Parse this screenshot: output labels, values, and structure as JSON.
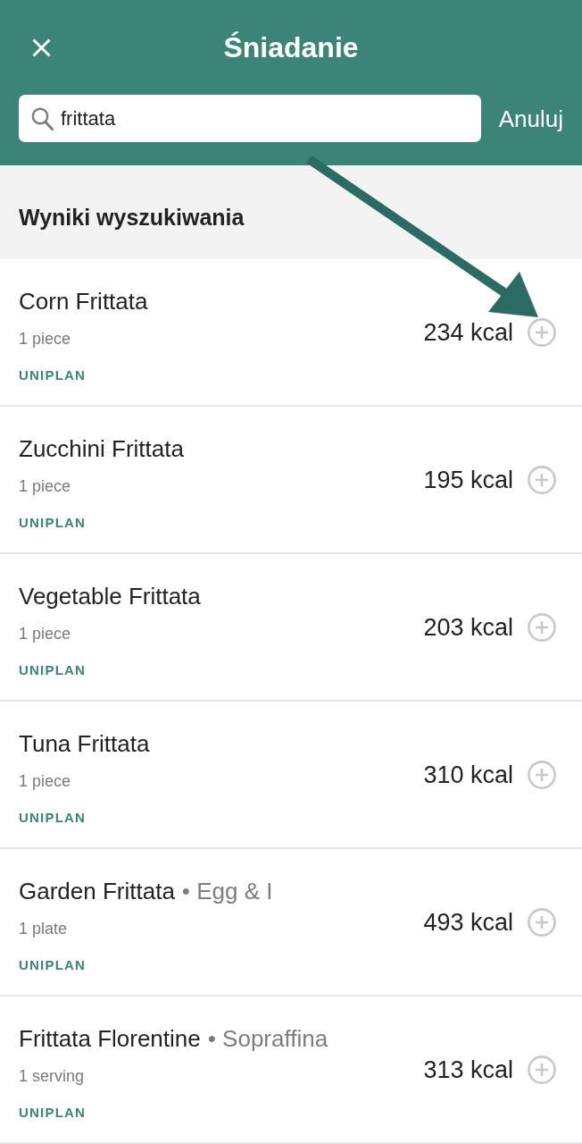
{
  "header": {
    "title": "Śniadanie",
    "search": {
      "value": "frittata"
    },
    "cancel": "Anuluj"
  },
  "section": {
    "title": "Wyniki wyszukiwania"
  },
  "results": [
    {
      "name": "Corn Frittata",
      "serving": "1 piece",
      "source": "UNIPLAN",
      "kcal": "234 kcal"
    },
    {
      "name": "Zucchini Frittata",
      "serving": "1 piece",
      "source": "UNIPLAN",
      "kcal": "195 kcal"
    },
    {
      "name": "Vegetable Frittata",
      "serving": "1 piece",
      "source": "UNIPLAN",
      "kcal": "203 kcal"
    },
    {
      "name": "Tuna Frittata",
      "serving": "1 piece",
      "source": "UNIPLAN",
      "kcal": "310 kcal"
    },
    {
      "name": "Garden Frittata",
      "brand": "• Egg & I",
      "serving": "1 plate",
      "source": "UNIPLAN",
      "kcal": "493 kcal"
    },
    {
      "name": "Frittata Florentine",
      "brand": "• Sopraffina",
      "serving": "1 serving",
      "source": "UNIPLAN",
      "kcal": "313 kcal"
    }
  ]
}
